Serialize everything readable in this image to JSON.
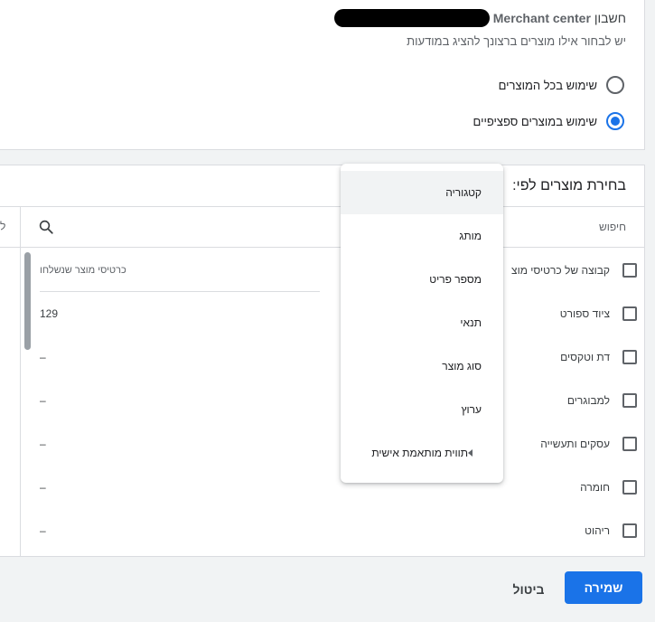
{
  "account": {
    "label": "חשבון",
    "merchant_center": "Merchant center",
    "subtitle": "יש לבחור אילו מוצרים ברצונך להציג במודעות"
  },
  "options": [
    {
      "label": "שימוש בכל המוצרים",
      "checked": false
    },
    {
      "label": "שימוש במוצרים ספציפיים",
      "checked": true
    }
  ],
  "selector": {
    "title": "בחירת מוצרים לפי:",
    "search_label": "חיפוש",
    "left_cut_label": "ל"
  },
  "list": {
    "header": "קבוצה של כרטיסי מוצ",
    "rows": [
      "ציוד ספורט",
      "דת וטקסים",
      "למבוגרים",
      "עסקים ותעשייה",
      "חומרה",
      "ריהוט"
    ]
  },
  "values": {
    "header": "כרטיסי מוצר שנשלחו",
    "cells": [
      "129",
      "–",
      "–",
      "–",
      "–",
      "–"
    ]
  },
  "menu": {
    "items": [
      "קטגוריה",
      "מותג",
      "מספר פריט",
      "תנאי",
      "סוג מוצר",
      "ערוץ",
      "תווית מותאמת אישית"
    ]
  },
  "footer": {
    "cancel": "ביטול",
    "save": "שמירה"
  },
  "colors": {
    "accent": "#1a73e8"
  }
}
